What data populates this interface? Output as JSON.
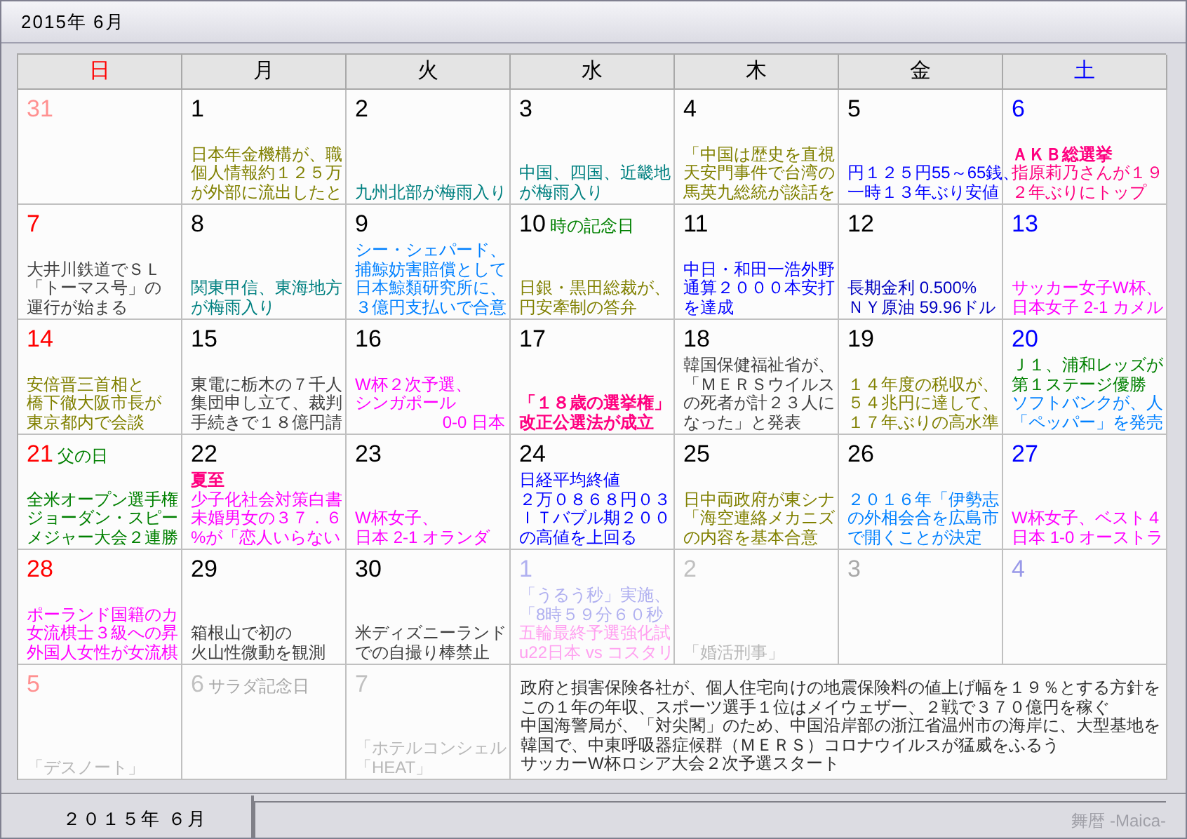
{
  "window": {
    "title": "2015年 6月"
  },
  "calendar": {
    "weekdays": [
      {
        "label": "日",
        "color": "#ff0000"
      },
      {
        "label": "月",
        "color": "#000000"
      },
      {
        "label": "火",
        "color": "#000000"
      },
      {
        "label": "水",
        "color": "#000000"
      },
      {
        "label": "木",
        "color": "#000000"
      },
      {
        "label": "金",
        "color": "#000000"
      },
      {
        "label": "土",
        "color": "#0000ff"
      }
    ],
    "weeks": [
      [
        {
          "kind": "day",
          "day": "31",
          "color": "#ff9090"
        },
        {
          "kind": "day",
          "day": "1",
          "color": "#000000",
          "lines": [
            {
              "text": "日本年金機構が、職",
              "color": "#808000"
            },
            {
              "text": "個人情報約１２５万",
              "color": "#808000"
            },
            {
              "text": "が外部に流出したと",
              "color": "#808000"
            }
          ]
        },
        {
          "kind": "day",
          "day": "2",
          "color": "#000000",
          "lines": [
            {
              "text": "九州北部が梅雨入り",
              "color": "#008080"
            }
          ]
        },
        {
          "kind": "day",
          "day": "3",
          "color": "#000000",
          "lines": [
            {
              "text": "中国、四国、近畿地",
              "color": "#008080"
            },
            {
              "text": "が梅雨入り",
              "color": "#008080"
            }
          ]
        },
        {
          "kind": "day",
          "day": "4",
          "color": "#000000",
          "lines": [
            {
              "text": "「中国は歴史を直視",
              "color": "#808000"
            },
            {
              "text": "天安門事件で台湾の",
              "color": "#808000"
            },
            {
              "text": "馬英九総統が談話を",
              "color": "#808000"
            }
          ]
        },
        {
          "kind": "day",
          "day": "5",
          "color": "#000000",
          "lines": [
            {
              "text": "円１２５円55～65銭、",
              "color": "#0000ff"
            },
            {
              "text": "一時１３年ぶり安値",
              "color": "#0000ff"
            }
          ]
        },
        {
          "kind": "day",
          "day": "6",
          "color": "#0000ff",
          "lines": [
            {
              "text": "ＡＫＢ総選挙",
              "color": "#ff0080",
              "bold": true
            },
            {
              "text": "指原莉乃さんが１９",
              "color": "#ff0080"
            },
            {
              "text": "２年ぶりにトップ",
              "color": "#ff0080"
            }
          ]
        }
      ],
      [
        {
          "kind": "day",
          "day": "7",
          "color": "#ff0000",
          "lines": [
            {
              "text": "大井川鉄道でＳＬ",
              "color": "#404040"
            },
            {
              "text": "「トーマス号」の",
              "color": "#404040"
            },
            {
              "text": "運行が始まる",
              "color": "#404040"
            }
          ]
        },
        {
          "kind": "day",
          "day": "8",
          "color": "#000000",
          "lines": [
            {
              "text": "関東甲信、東海地方",
              "color": "#008080"
            },
            {
              "text": "が梅雨入り",
              "color": "#008080"
            }
          ]
        },
        {
          "kind": "day",
          "day": "9",
          "color": "#000000",
          "lines": [
            {
              "text": "シー・シェパード、",
              "color": "#0080ff"
            },
            {
              "text": "捕鯨妨害賠償として",
              "color": "#0080ff"
            },
            {
              "text": "日本鯨類研究所に、",
              "color": "#0080ff"
            },
            {
              "text": "３億円支払いで合意",
              "color": "#0080ff"
            }
          ]
        },
        {
          "kind": "day",
          "day": "10",
          "color": "#000000",
          "note": {
            "text": "時の記念日",
            "color": "#008000"
          },
          "lines": [
            {
              "text": "日銀・黒田総裁が、",
              "color": "#808000"
            },
            {
              "text": "円安牽制の答弁",
              "color": "#808000"
            }
          ]
        },
        {
          "kind": "day",
          "day": "11",
          "color": "#000000",
          "lines": [
            {
              "text": "中日・和田一浩外野",
              "color": "#0000ff"
            },
            {
              "text": "通算２０００本安打",
              "color": "#0000ff"
            },
            {
              "text": "を達成",
              "color": "#0000ff"
            }
          ]
        },
        {
          "kind": "day",
          "day": "12",
          "color": "#000000",
          "lines": [
            {
              "text": "長期金利 0.500%",
              "color": "#0000c0"
            },
            {
              "text": "ＮＹ原油 59.96ドル",
              "color": "#0000c0"
            }
          ]
        },
        {
          "kind": "day",
          "day": "13",
          "color": "#0000ff",
          "lines": [
            {
              "text": "サッカー女子W杯、",
              "color": "#ff00ff"
            },
            {
              "text": "日本女子 2-1 カメル",
              "color": "#ff00ff"
            }
          ]
        }
      ],
      [
        {
          "kind": "day",
          "day": "14",
          "color": "#ff0000",
          "lines": [
            {
              "text": "安倍晋三首相と",
              "color": "#808000"
            },
            {
              "text": "橋下徹大阪市長が",
              "color": "#808000"
            },
            {
              "text": "東京都内で会談",
              "color": "#808000"
            }
          ]
        },
        {
          "kind": "day",
          "day": "15",
          "color": "#000000",
          "lines": [
            {
              "text": "東電に栃木の７千人",
              "color": "#404040"
            },
            {
              "text": "集団申し立て、裁判",
              "color": "#404040"
            },
            {
              "text": "手続きで１８億円請",
              "color": "#404040"
            }
          ]
        },
        {
          "kind": "day",
          "day": "16",
          "color": "#000000",
          "lines": [
            {
              "text": "W杯２次予選、",
              "color": "#ff00ff"
            },
            {
              "text": "シンガポール",
              "color": "#ff00ff"
            },
            {
              "text": "0-0 日本",
              "color": "#ff00ff",
              "right_aligned": true
            }
          ]
        },
        {
          "kind": "day",
          "day": "17",
          "color": "#000000",
          "lines": [
            {
              "text": "「１８歳の選挙権」",
              "color": "#ff0080",
              "bold": true
            },
            {
              "text": "改正公選法が成立",
              "color": "#ff0080",
              "bold": true
            }
          ]
        },
        {
          "kind": "day",
          "day": "18",
          "color": "#000000",
          "lines": [
            {
              "text": "韓国保健福祉省が、",
              "color": "#404040"
            },
            {
              "text": "「ＭＥＲＳウイルス",
              "color": "#404040"
            },
            {
              "text": "の死者が計２３人に",
              "color": "#404040"
            },
            {
              "text": "なった」と発表",
              "color": "#404040"
            }
          ]
        },
        {
          "kind": "day",
          "day": "19",
          "color": "#000000",
          "lines": [
            {
              "text": "１４年度の税収が、",
              "color": "#808000"
            },
            {
              "text": "５４兆円に達して、",
              "color": "#808000"
            },
            {
              "text": "１７年ぶりの高水準",
              "color": "#808000"
            }
          ]
        },
        {
          "kind": "day",
          "day": "20",
          "color": "#0000ff",
          "lines": [
            {
              "text": "Ｊ１、浦和レッズが",
              "color": "#008000"
            },
            {
              "text": "第１ステージ優勝",
              "color": "#008000"
            },
            {
              "text": "ソフトバンクが、人",
              "color": "#0080ff"
            },
            {
              "text": "「ペッパー」を発売",
              "color": "#0080ff"
            }
          ]
        }
      ],
      [
        {
          "kind": "day",
          "day": "21",
          "color": "#ff0000",
          "note": {
            "text": "父の日",
            "color": "#008000"
          },
          "lines": [
            {
              "text": "全米オープン選手権",
              "color": "#008000"
            },
            {
              "text": "ジョーダン・スピー",
              "color": "#008000"
            },
            {
              "text": "メジャー大会２連勝",
              "color": "#008000"
            }
          ]
        },
        {
          "kind": "day",
          "day": "22",
          "color": "#000000",
          "lines": [
            {
              "text": "夏至",
              "color": "#ff0080",
              "bold": true
            },
            {
              "text": "少子化社会対策白書",
              "color": "#ff00ff"
            },
            {
              "text": "未婚男女の３７．６",
              "color": "#ff00ff"
            },
            {
              "text": "%が「恋人いらない",
              "color": "#ff00ff"
            }
          ]
        },
        {
          "kind": "day",
          "day": "23",
          "color": "#000000",
          "lines": [
            {
              "text": "W杯女子、",
              "color": "#ff00ff"
            },
            {
              "text": "日本 2-1 オランダ",
              "color": "#ff00ff"
            }
          ]
        },
        {
          "kind": "day",
          "day": "24",
          "color": "#000000",
          "lines": [
            {
              "text": "日経平均終値",
              "color": "#0000ff"
            },
            {
              "text": "２万０８６８円０３",
              "color": "#0000ff"
            },
            {
              "text": "ＩＴバブル期２００",
              "color": "#0000ff"
            },
            {
              "text": "の高値を上回る",
              "color": "#0000ff"
            }
          ]
        },
        {
          "kind": "day",
          "day": "25",
          "color": "#000000",
          "lines": [
            {
              "text": "日中両政府が東シナ",
              "color": "#808000"
            },
            {
              "text": "「海空連絡メカニズ",
              "color": "#808000"
            },
            {
              "text": "の内容を基本合意",
              "color": "#808000"
            }
          ]
        },
        {
          "kind": "day",
          "day": "26",
          "color": "#000000",
          "lines": [
            {
              "text": "２０１６年「伊勢志",
              "color": "#0080ff"
            },
            {
              "text": "の外相会合を広島市",
              "color": "#0080ff"
            },
            {
              "text": "で開くことが決定",
              "color": "#0080ff"
            }
          ]
        },
        {
          "kind": "day",
          "day": "27",
          "color": "#0000ff",
          "lines": [
            {
              "text": "W杯女子、ベスト４",
              "color": "#ff00ff"
            },
            {
              "text": "日本 1-0 オーストラ",
              "color": "#ff00ff"
            }
          ]
        }
      ],
      [
        {
          "kind": "day",
          "day": "28",
          "color": "#ff0000",
          "lines": [
            {
              "text": "ポーランド国籍のカ",
              "color": "#ff00ff"
            },
            {
              "text": "女流棋士３級への昇",
              "color": "#ff00ff"
            },
            {
              "text": "外国人女性が女流棋",
              "color": "#ff00ff"
            }
          ]
        },
        {
          "kind": "day",
          "day": "29",
          "color": "#000000",
          "lines": [
            {
              "text": "箱根山で初の",
              "color": "#404040"
            },
            {
              "text": "火山性微動を観測",
              "color": "#404040"
            }
          ]
        },
        {
          "kind": "day",
          "day": "30",
          "color": "#000000",
          "lines": [
            {
              "text": "米ディズニーランド",
              "color": "#404040"
            },
            {
              "text": "での自撮り棒禁止",
              "color": "#404040"
            }
          ]
        },
        {
          "kind": "day",
          "day": "1",
          "color": "#b0b0f0",
          "lines": [
            {
              "text": "「うるう秒」実施、",
              "color": "#b0b0f0"
            },
            {
              "text": "「8時５９分６０秒",
              "color": "#b0b0f0"
            },
            {
              "text": "五輪最終予選強化試",
              "color": "#ffa0f0"
            },
            {
              "text": "u22日本 vs コスタリ",
              "color": "#ffa0f0"
            }
          ]
        },
        {
          "kind": "day",
          "day": "2",
          "color": "#c0c0c0",
          "lines": [
            {
              "text": "「婚活刑事」",
              "color": "#b8b8b8"
            }
          ]
        },
        {
          "kind": "day",
          "day": "3",
          "color": "#a8a8a8"
        },
        {
          "kind": "day",
          "day": "4",
          "color": "#9898e8"
        }
      ],
      [
        {
          "kind": "day",
          "day": "5",
          "color": "#ff9090",
          "lines": [
            {
              "text": "「デスノート」",
              "color": "#b8b8b8"
            }
          ]
        },
        {
          "kind": "day",
          "day": "6",
          "color": "#c0c0c0",
          "note": {
            "text": "サラダ記念日",
            "color": "#a8a8a8"
          }
        },
        {
          "kind": "day",
          "day": "7",
          "color": "#c0c0c0",
          "lines": [
            {
              "text": "「ホテルコンシェル",
              "color": "#b8b8b8"
            },
            {
              "text": "「HEAT」",
              "color": "#b8b8b8"
            }
          ]
        },
        {
          "kind": "news",
          "lines": [
            {
              "text": "政府と損害保険各社が、個人住宅向けの地震保険料の値上げ幅を１９％とする方針を",
              "color": "#303030"
            },
            {
              "text": "この１年の年収、スポーツ選手１位はメイウェザー、２戦で３７０億円を稼ぐ",
              "color": "#303030"
            },
            {
              "text": "中国海警局が、「対尖閣」のため、中国沿岸部の浙江省温州市の海岸に、大型基地を",
              "color": "#303030"
            },
            {
              "text": "韓国で、中東呼吸器症候群（ＭＥＲＳ）コロナウイルスが猛威をふるう",
              "color": "#303030"
            },
            {
              "text": "サッカーW杯ロシア大会２次予選スタート",
              "color": "#303030"
            }
          ]
        }
      ]
    ]
  },
  "tabs": [
    {
      "label": "２０１５年 ６月",
      "selected": true
    }
  ],
  "footer": {
    "app_name": "舞暦 -Maica-"
  }
}
